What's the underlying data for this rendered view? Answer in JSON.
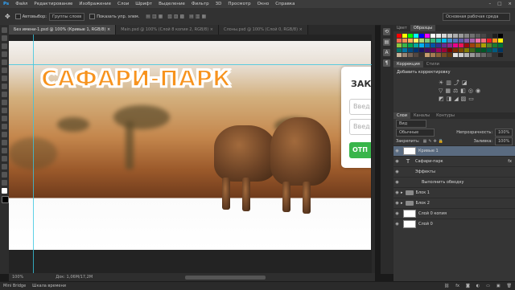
{
  "menu": [
    "Файл",
    "Редактирование",
    "Изображение",
    "Слои",
    "Шрифт",
    "Выделение",
    "Фильтр",
    "3D",
    "Просмотр",
    "Окно",
    "Справка"
  ],
  "options": {
    "autoselect_label": "Автовыбор:",
    "autoselect_value": "Группы слоев",
    "transform_label": "Показать упр. элем.",
    "workspace": "Основная рабочая среда"
  },
  "tabs": [
    "Без имени-1.psd @ 100% (Кривые 1, RGB/8) ×",
    "Main.psd @ 100% (Слой 8 копия 2, RGB/8) ×",
    "Слоны.psd @ 100% (Слой 0, RGB/8) ×"
  ],
  "canvas": {
    "logo": "САФАРИ-ПАРК",
    "form_title": "ЗАКА",
    "input1": "Введ",
    "input2": "Введ",
    "button": "ОТП"
  },
  "status": {
    "zoom": "100%",
    "doc": "Док: 1,06M/17,2M"
  },
  "bottom": {
    "mini_bridge": "Mini Bridge",
    "timeline": "Шкала времени"
  },
  "color_panel": {
    "tabs": [
      "Цвет",
      "Образцы"
    ],
    "active": "Образцы"
  },
  "swatch_colors": [
    "#ff0000",
    "#ffff00",
    "#00ff00",
    "#00ffff",
    "#0000ff",
    "#ff00ff",
    "#ffffff",
    "#ebebeb",
    "#d6d6d6",
    "#c2c2c2",
    "#adadad",
    "#999999",
    "#858585",
    "#707070",
    "#5c5c5c",
    "#474747",
    "#333333",
    "#1f1f1f",
    "#000000",
    "#f26c4f",
    "#f68e55",
    "#fbaf5c",
    "#fff467",
    "#acd372",
    "#7cc576",
    "#3bb878",
    "#1abbb4",
    "#00bff3",
    "#438ccb",
    "#5574b9",
    "#605ca8",
    "#855fa8",
    "#a763a8",
    "#f06ea9",
    "#f26d7d",
    "#ed1c24",
    "#f7941d",
    "#fff200",
    "#8dc63f",
    "#39b54a",
    "#00a651",
    "#00a99d",
    "#00aeef",
    "#0072bc",
    "#0054a6",
    "#2e3192",
    "#662d91",
    "#92278f",
    "#ec008c",
    "#ed145b",
    "#9e0b0f",
    "#a0410d",
    "#a36209",
    "#aba000",
    "#598527",
    "#1a7b30",
    "#007236",
    "#00746b",
    "#0076a3",
    "#004b80",
    "#003471",
    "#1b1464",
    "#440e62",
    "#630460",
    "#9e005d",
    "#9e0039",
    "#790000",
    "#7b2e00",
    "#7d4900",
    "#827b00",
    "#406618",
    "#005e20",
    "#005826",
    "#005952",
    "#005b7f",
    "#003663",
    "#c7b299",
    "#998675",
    "#736357",
    "#534741",
    "#37302d",
    "#c69c6d",
    "#a67c52",
    "#8c6239",
    "#754c24",
    "#603913",
    "#e2e2e2",
    "#cccccc",
    "#b3b3b3",
    "#999999",
    "#808080",
    "#666666",
    "#4d4d4d",
    "#333333",
    "#1a1a1a"
  ],
  "adjust_panel": {
    "tabs": [
      "Коррекция",
      "Стили"
    ],
    "title": "Добавить корректировку"
  },
  "layers_panel": {
    "tabs": [
      "Слои",
      "Каналы",
      "Контуры"
    ],
    "filter": "Вид",
    "blend": "Обычные",
    "opacity_label": "Непрозрачность:",
    "opacity": "100%",
    "lock_label": "Закрепить:",
    "fill_label": "Заливка:",
    "fill": "100%",
    "layers": [
      {
        "name": "Кривые 1",
        "kind": "adjust"
      },
      {
        "name": "Сафари-парк",
        "kind": "text"
      },
      {
        "name": "Эффекты",
        "kind": "fx"
      },
      {
        "name": "Выполнить обводку",
        "kind": "fx-item"
      },
      {
        "name": "Блок 1",
        "kind": "group"
      },
      {
        "name": "Блок 2",
        "kind": "group"
      },
      {
        "name": "Слой 0 копия",
        "kind": "pixel"
      },
      {
        "name": "Слой 0",
        "kind": "pixel"
      }
    ]
  }
}
